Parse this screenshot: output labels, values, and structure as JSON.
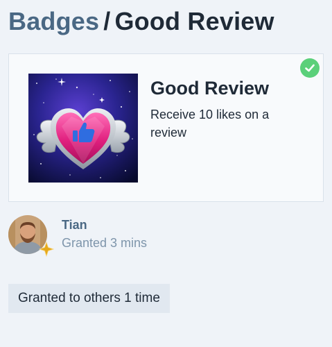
{
  "breadcrumb": {
    "parent_label": "Badges",
    "separator": "/",
    "current_label": "Good Review"
  },
  "badge": {
    "name": "Good Review",
    "description": "Receive 10 likes on a review",
    "granted_icon": "check-circle-icon",
    "image_icon": "heart-thumbs-up-winged-badge"
  },
  "grant": {
    "user_name": "Tian",
    "time_label": "Granted 3 mins",
    "flair_icon": "sparkle-icon"
  },
  "others": {
    "label": "Granted to others 1 time"
  },
  "colors": {
    "background": "#eff3f8",
    "link": "#4a6884",
    "muted": "#7e95ab",
    "check": "#5bd07a",
    "flair": "#e5a91c"
  }
}
